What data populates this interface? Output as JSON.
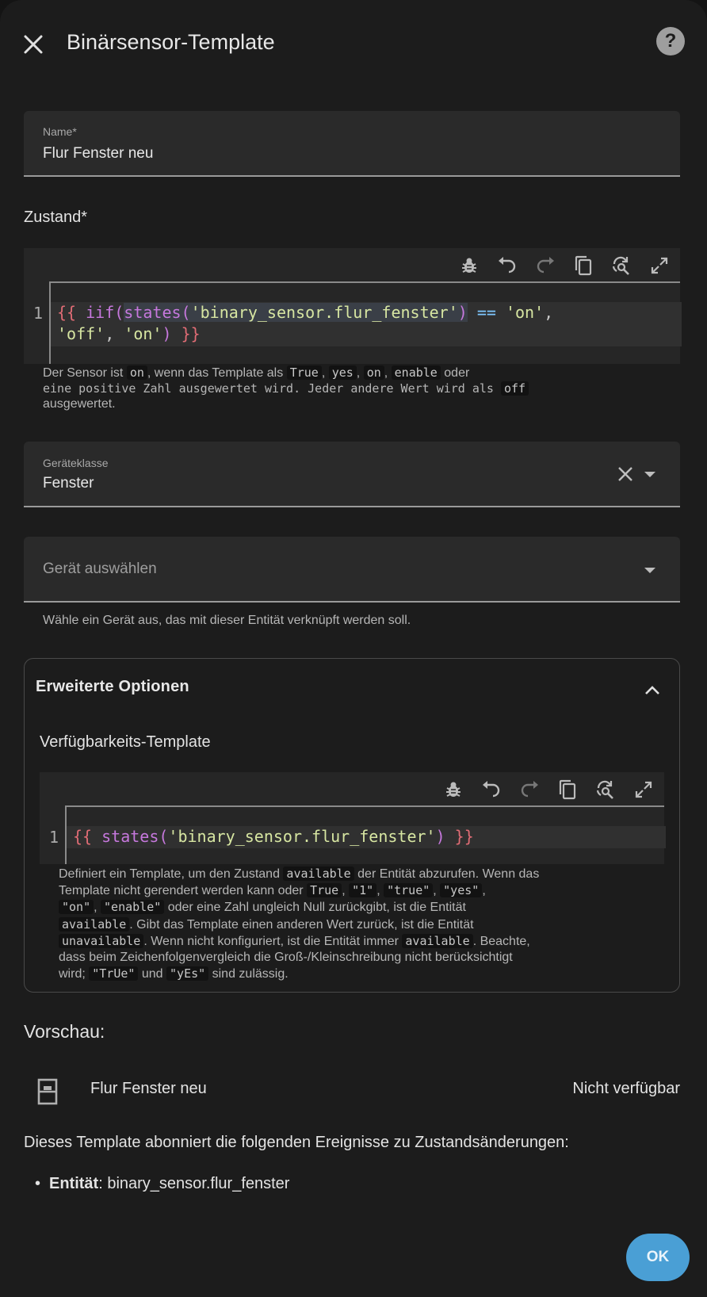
{
  "dialog": {
    "title": "Binärsensor-Template"
  },
  "name_field": {
    "label": "Name*",
    "value": "Flur Fenster neu"
  },
  "state": {
    "label": "Zustand*",
    "line_number": "1",
    "code_line1_a": "{{ ",
    "code_line1_b": "iif(",
    "code_line1_c": "states(",
    "code_line1_d": "'binary_sensor.flur_fenster'",
    "code_line1_e": ")",
    "code_line1_f": " == ",
    "code_line1_g": "'on'",
    "code_line1_h": ",",
    "code_line2_a": "'off'",
    "code_line2_b": ", ",
    "code_line2_c": "'on'",
    "code_line2_d": ")",
    "code_line2_e": " }}",
    "help_1": "Der Sensor ist ",
    "help_code_on": "on",
    "help_2": ", wenn das Template als ",
    "help_code_true": "True",
    "help_code_yes": "yes",
    "help_code_on2": "on",
    "help_code_enable": "enable",
    "help_3": " oder",
    "help_line2": "eine positive Zahl ausgewertet wird. Jeder andere Wert wird als ",
    "help_code_off": "off",
    "help_line3": "ausgewertet."
  },
  "device_class": {
    "label": "Geräteklasse",
    "value": "Fenster"
  },
  "device_select": {
    "placeholder": "Gerät auswählen",
    "helper": "Wähle ein Gerät aus, das mit dieser Entität verknüpft werden soll."
  },
  "advanced": {
    "title": "Erweiterte Optionen",
    "availability_label": "Verfügbarkeits-Template",
    "line_number": "1",
    "code_a": "{{ ",
    "code_b": "states(",
    "code_c": "'binary_sensor.flur_fenster'",
    "code_d": ")",
    "code_e": " }}",
    "h1": "Definiert ein Template, um den Zustand ",
    "h_available": "available",
    "h2": " der Entität abzurufen. Wenn das",
    "h3": "Template nicht gerendert werden kann oder ",
    "h_true": "True",
    "h_1": "\"1\"",
    "h_true2": "\"true\"",
    "h_yes": "\"yes\"",
    "h_on": "\"on\"",
    "h_enable": "\"enable\"",
    "h4": " oder eine Zahl ungleich Null zurückgibt, ist die Entität",
    "h_available2": "available",
    "h5": ". Gibt das Template einen anderen Wert zurück, ist die Entität",
    "h_unavailable": "unavailable",
    "h6": ". Wenn nicht konfiguriert, ist die Entität immer ",
    "h_available3": "available",
    "h7": ". Beachte,",
    "h8": "dass beim Zeichenfolgenvergleich die Groß-/Kleinschreibung nicht berücksichtigt",
    "h9": "wird; ",
    "h_TrUe": "\"TrUe\"",
    "h10": " und ",
    "h_yEs": "\"yEs\"",
    "h11": " sind zulässig."
  },
  "preview": {
    "title": "Vorschau:",
    "entity_name": "Flur Fenster neu",
    "entity_state": "Nicht verfügbar"
  },
  "subscriptions": {
    "text": "Dieses Template abonniert die folgenden Ereignisse zu Zustandsänderungen:",
    "entity_label": "Entität",
    "entity_value": ": binary_sensor.flur_fenster"
  },
  "buttons": {
    "ok": "OK"
  }
}
